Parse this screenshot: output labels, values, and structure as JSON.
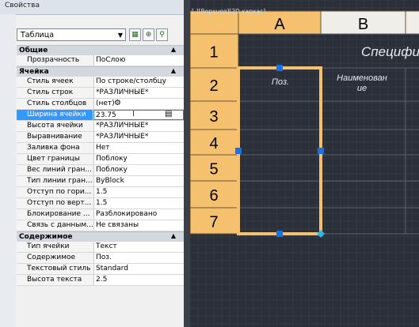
{
  "palette": {
    "title": "Свойства",
    "object_type": "Таблица",
    "sections": [
      {
        "title": "Общие",
        "rows": [
          {
            "k": "Прозрачность",
            "v": "ПоСлою"
          }
        ]
      },
      {
        "title": "Ячейка",
        "rows": [
          {
            "k": "Стиль ячеек",
            "v": "По строке/столбцу"
          },
          {
            "k": "Стиль строк",
            "v": "*РАЗЛИЧНЫЕ*"
          },
          {
            "k": "Стиль столбцов",
            "v": "(нет)"
          },
          {
            "k": "Ширина ячейки",
            "v": "23.75"
          },
          {
            "k": "Высота ячейки",
            "v": "*РАЗЛИЧНЫЕ*"
          },
          {
            "k": "Выравнивание",
            "v": "*РАЗЛИЧНЫЕ*"
          },
          {
            "k": "Заливка фона",
            "v": "Нет"
          },
          {
            "k": "Цвет границы",
            "v": "Поблоку"
          },
          {
            "k": "Вес линий гран...",
            "v": "Поблоку"
          },
          {
            "k": "Тип линии гран...",
            "v": "ByBlock"
          },
          {
            "k": "Отступ по гори...",
            "v": "1.5"
          },
          {
            "k": "Отступ по верт...",
            "v": "1.5"
          },
          {
            "k": "Блокирование ...",
            "v": "Разблокировано"
          },
          {
            "k": "Связь с данным...",
            "v": "Не связаны"
          }
        ]
      },
      {
        "title": "Содержимое",
        "rows": [
          {
            "k": "Тип ячейки",
            "v": "Текст"
          },
          {
            "k": "Содержимое",
            "v": "Поз."
          },
          {
            "k": "Текстовый стиль",
            "v": "Standard"
          },
          {
            "k": "Высота текста",
            "v": "2.5"
          }
        ]
      }
    ]
  },
  "drawing": {
    "viewport_label": "[-][Верхняя][2D каркас]",
    "columns": [
      "A",
      "B"
    ],
    "rows": [
      "1",
      "2",
      "3",
      "4",
      "5",
      "6",
      "7"
    ],
    "title_text": "Специфи",
    "header_cells": {
      "a2": "Поз.",
      "b2": "Наименование"
    },
    "b2_line1": "Наименован",
    "b2_line2": "ие",
    "colors": {
      "highlight": "#f5c16f",
      "grip": "#1e6fe0",
      "background": "#2b2f38"
    }
  }
}
